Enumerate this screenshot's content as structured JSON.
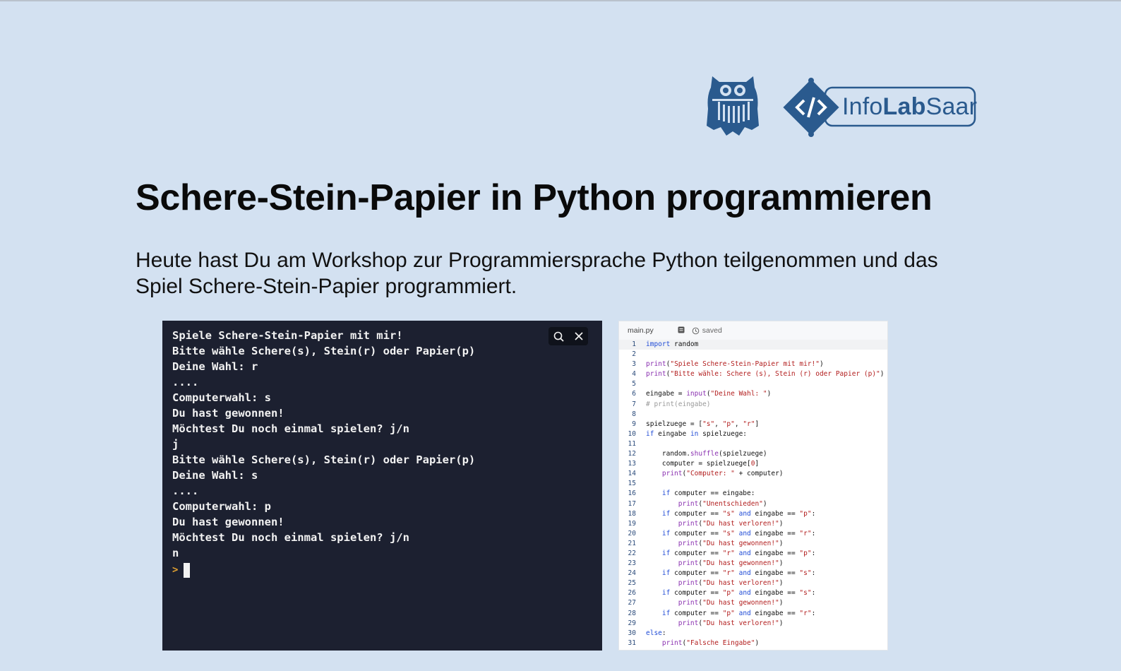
{
  "logos": {
    "infolab_brand_text": "InfoLabSaar",
    "infolab_part1": "Info",
    "infolab_part2": "Lab",
    "infolab_part3": "Saar"
  },
  "page": {
    "title": "Schere-Stein-Papier in Python programmieren",
    "intro": "Heute hast Du am Workshop zur Programmiersprache Python teilgenommen und das Spiel Schere-Stein-Papier programmiert."
  },
  "terminal": {
    "lines": [
      "Spiele Schere-Stein-Papier mit mir!",
      "Bitte wähle Schere(s), Stein(r) oder Papier(p)",
      "Deine Wahl: r",
      "....",
      "Computerwahl: s",
      "Du hast gewonnen!",
      "Möchtest Du noch einmal spielen? j/n",
      "j",
      "Bitte wähle Schere(s), Stein(r) oder Papier(p)",
      "Deine Wahl: s",
      "....",
      "Computerwahl: p",
      "Du hast gewonnen!",
      "Möchtest Du noch einmal spielen? j/n",
      "n"
    ],
    "prompt_symbol": ">",
    "search_icon": "search-icon",
    "close_icon": "close-icon"
  },
  "editor": {
    "filename": "main.py",
    "status": "saved",
    "code": [
      "import random",
      "",
      "print(\"Spiele Schere-Stein-Papier mit mir!\")",
      "print(\"Bitte wähle: Schere (s), Stein (r) oder Papier (p)\")",
      "",
      "eingabe = input(\"Deine Wahl: \")",
      "# print(eingabe)",
      "",
      "spielzuege = [\"s\", \"p\", \"r\"]",
      "if eingabe in spielzuege:",
      "",
      "    random.shuffle(spielzuege)",
      "    computer = spielzuege[0]",
      "    print(\"Computer: \" + computer)",
      "",
      "    if computer == eingabe:",
      "        print(\"Unentschieden\")",
      "    if computer == \"s\" and eingabe == \"p\":",
      "        print(\"Du hast verloren!\")",
      "    if computer == \"s\" and eingabe == \"r\":",
      "        print(\"Du hast gewonnen!\")",
      "    if computer == \"r\" and eingabe == \"p\":",
      "        print(\"Du hast gewonnen!\")",
      "    if computer == \"r\" and eingabe == \"s\":",
      "        print(\"Du hast verloren!\")",
      "    if computer == \"p\" and eingabe == \"s\":",
      "        print(\"Du hast gewonnen!\")",
      "    if computer == \"p\" and eingabe == \"r\":",
      "        print(\"Du hast verloren!\")",
      "else:",
      "    print(\"Falsche Eingabe\")"
    ]
  },
  "colors": {
    "background": "#d3e1f1",
    "terminal_bg": "#1c2030",
    "brand_blue": "#2a5a8e"
  }
}
